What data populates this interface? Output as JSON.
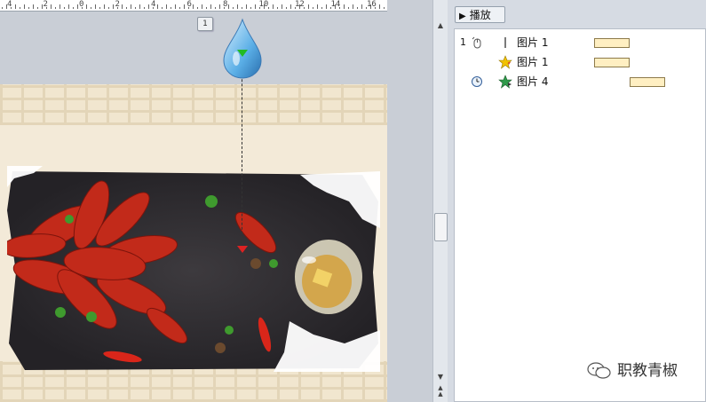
{
  "ruler": {
    "labels": [
      "4",
      "2",
      "0",
      "2",
      "4",
      "6",
      "8",
      "10",
      "12",
      "14",
      "16"
    ]
  },
  "page_badge": "1",
  "animation_pane": {
    "play_button_label": "播放",
    "play_icon": "play-icon",
    "items": [
      {
        "index": "1",
        "trigger_icon": "mouse-click-icon",
        "effect_icon": "motion-path-line-icon",
        "name": "图片 1"
      },
      {
        "index": "",
        "trigger_icon": "",
        "effect_icon": "emphasis-star-icon",
        "name": "图片 1"
      },
      {
        "index": "",
        "trigger_icon": "clock-icon",
        "effect_icon": "exit-star-icon",
        "name": "图片 4"
      }
    ]
  },
  "watermark": {
    "icon": "wechat-icon",
    "text": "职教青椒"
  },
  "colors": {
    "timing_bar_fill": "#ffefc2",
    "motion_start_marker": "#22bb22",
    "motion_end_marker": "#dd2222"
  }
}
